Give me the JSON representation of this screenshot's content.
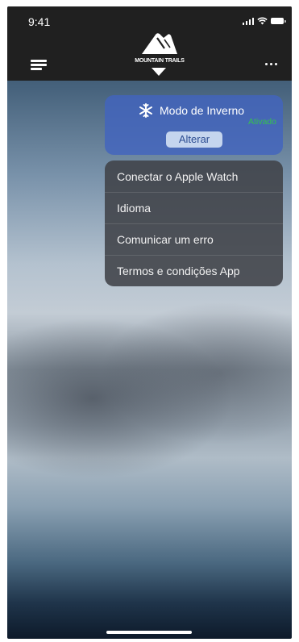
{
  "status_bar": {
    "time": "9:41"
  },
  "header": {
    "logo_text": "MOUNTAIN TRAILS",
    "menu_icon": "hamburger-menu-icon",
    "more_icon": "more-horizontal-icon"
  },
  "winter_mode": {
    "icon": "snowflake-icon",
    "title": "Modo de Inverno",
    "status": "Ativado",
    "button_label": "Alterar"
  },
  "menu": {
    "items": [
      {
        "label": "Conectar o Apple Watch"
      },
      {
        "label": "Idioma"
      },
      {
        "label": "Comunicar um erro"
      },
      {
        "label": "Termos e condições App"
      }
    ]
  },
  "colors": {
    "topbar": "#202020",
    "winter_card": "#4264be",
    "status_green": "#35c24f",
    "button_bg": "#c5d5ee",
    "menu_bg": "#404248"
  }
}
